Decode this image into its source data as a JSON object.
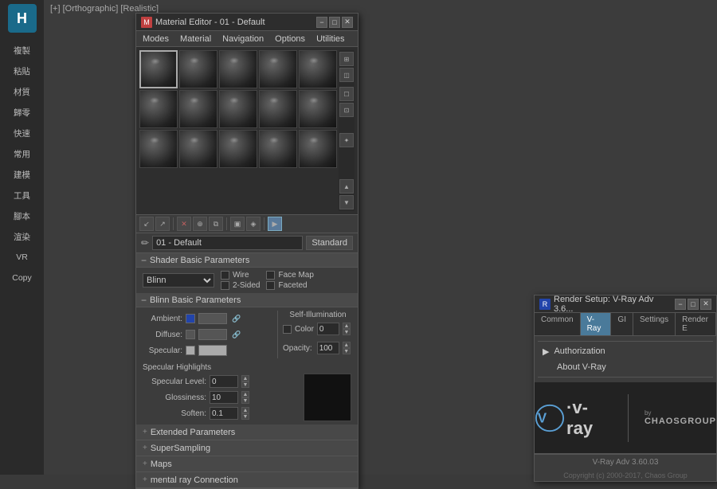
{
  "sidebar": {
    "logo": "H",
    "items": [
      {
        "label": "複製"
      },
      {
        "label": "粘貼"
      },
      {
        "label": "材質"
      },
      {
        "label": "歸零"
      },
      {
        "label": "快速"
      },
      {
        "label": "常用"
      },
      {
        "label": "建模"
      },
      {
        "label": "工具"
      },
      {
        "label": "腳本"
      },
      {
        "label": "渲染"
      },
      {
        "label": "VR"
      },
      {
        "label": "Copy"
      }
    ]
  },
  "viewport": {
    "label": "[+] [Orthographic] [Realistic]"
  },
  "material_editor": {
    "title": "Material Editor - 01 - Default",
    "menu": [
      "Modes",
      "Material",
      "Navigation",
      "Options",
      "Utilities"
    ],
    "name_field": "01 - Default",
    "standard_label": "Standard",
    "shader_basic_params": "Shader Basic Parameters",
    "shader_type": "Blinn",
    "checkboxes": {
      "wire": "Wire",
      "two_sided": "2-Sided",
      "face_map": "Face Map",
      "faceted": "Faceted"
    },
    "blinn_basic_params": "Blinn Basic Parameters",
    "self_illumination": "Self-Illumination",
    "color_label": "Color",
    "color_value": "0",
    "ambient_label": "Ambient:",
    "diffuse_label": "Diffuse:",
    "specular_label": "Specular:",
    "opacity_label": "Opacity:",
    "opacity_value": "100",
    "specular_highlights": "Specular Highlights",
    "specular_level_label": "Specular Level:",
    "specular_level_value": "0",
    "glossiness_label": "Glossiness:",
    "glossiness_value": "10",
    "soften_label": "Soften:",
    "soften_value": "0.1",
    "extended_params": "Extended Parameters",
    "supersampling": "SuperSampling",
    "maps": "Maps",
    "mental_ray": "mental ray Connection"
  },
  "render_setup": {
    "title": "Render Setup: V-Ray Adv 3.6...",
    "tabs": [
      "Common",
      "V-Ray",
      "GI",
      "Settings",
      "Render E"
    ],
    "menu_items": [
      {
        "label": "Authorization",
        "has_arrow": true
      },
      {
        "label": "About V-Ray",
        "has_arrow": false
      }
    ],
    "vray_logo": "V-Ray",
    "by_label": "by",
    "chaos_label": "CHAOSGROUP",
    "version": "V-Ray Adv 3.60.03",
    "copyright": "Copyright (c) 2000-2017, Chaos Group"
  },
  "icons": {
    "pencil": "✏",
    "brush": "🖌",
    "plus": "+",
    "minus": "−",
    "arrow_right": "▶",
    "checkmark": "✓",
    "cross": "✕",
    "window_close": "✕",
    "window_min": "−",
    "window_max": "□",
    "spinner_up": "▲",
    "spinner_down": "▼"
  }
}
